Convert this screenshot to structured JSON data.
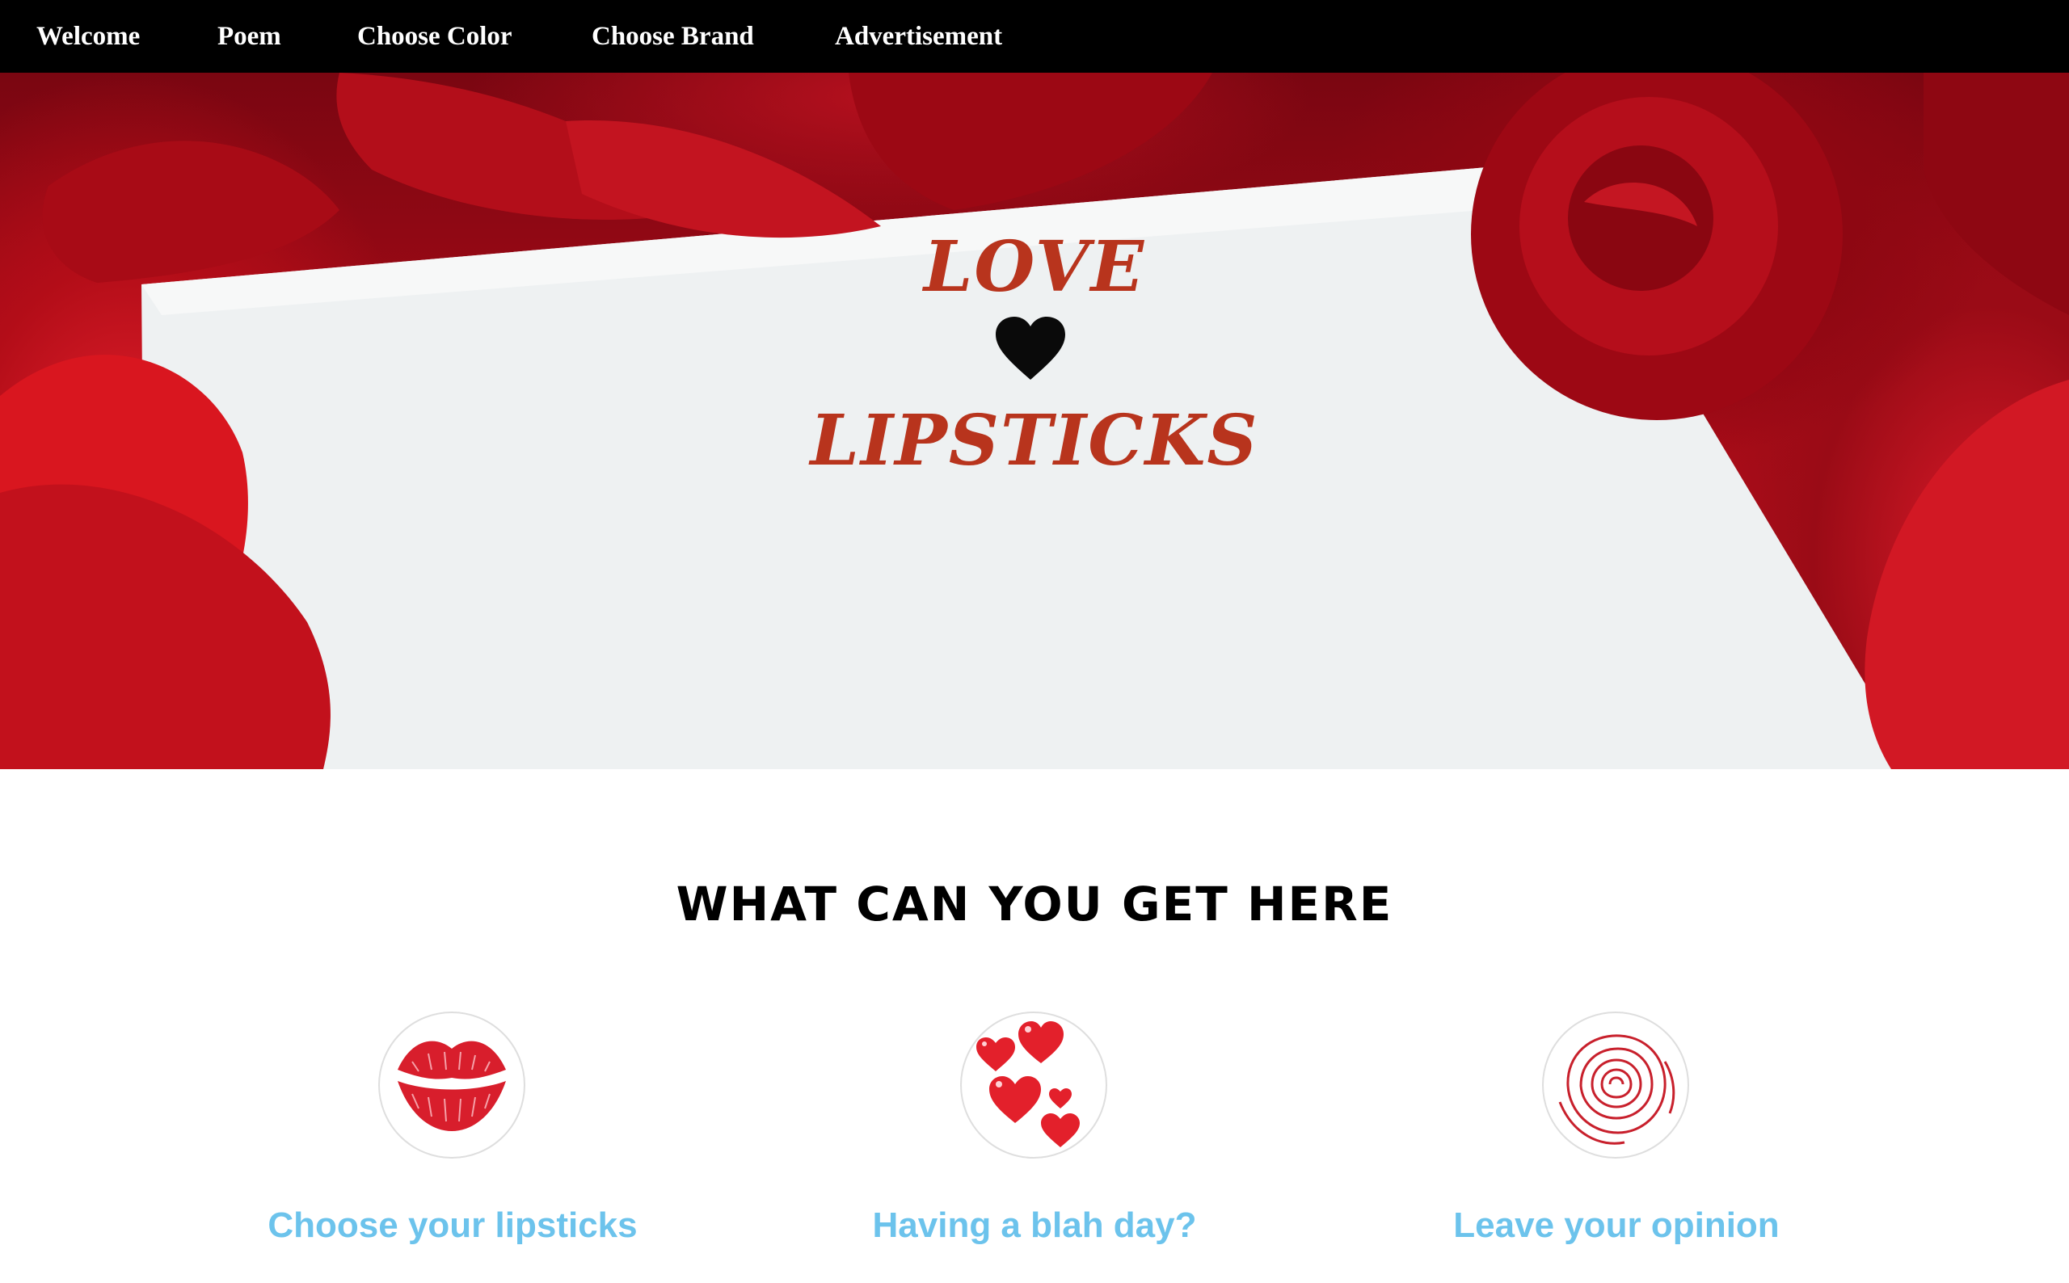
{
  "nav": {
    "items": [
      "Welcome",
      "Poem",
      "Choose Color",
      "Choose Brand",
      "Advertisement"
    ]
  },
  "hero": {
    "title_top": "LOVE",
    "heart_icon": "heart-icon",
    "title_bottom": "LIPSTICKS"
  },
  "section": {
    "title": "WHAT CAN YOU GET HERE",
    "features": [
      {
        "icon": "lips-icon",
        "label": "Choose your lipsticks"
      },
      {
        "icon": "hearts-icon",
        "label": "Having a blah day?"
      },
      {
        "icon": "rose-icon",
        "label": "Leave your opinion"
      }
    ]
  },
  "colors": {
    "nav_bg": "#000000",
    "hero_title": "#b8341d",
    "feature_link": "#6cc3ec",
    "rose_red": "#c0101e"
  }
}
